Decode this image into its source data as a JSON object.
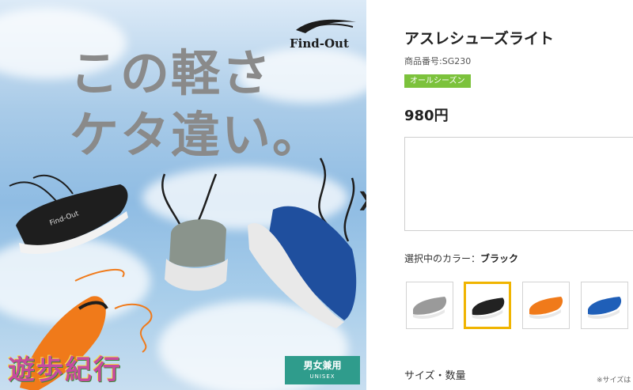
{
  "banner": {
    "brand": "Find-Out",
    "headline_line1": "この軽さ",
    "headline_line2": "ケタ違い。",
    "unisex_main": "男女兼用",
    "unisex_sub": "UNISEX",
    "watermark": "遊歩紀行",
    "next_arrow": "❯",
    "shoe_colors": [
      "#1e1e1e",
      "#8a948c",
      "#1f4f9e",
      "#f07a1a"
    ]
  },
  "product": {
    "title": "アスレシューズライト",
    "code": "商品番号:SG230",
    "badge": "オールシーズン",
    "badge_color": "#7cc23c",
    "price": "980円",
    "selected_color_label": "選択中のカラー：",
    "selected_color_value": "ブラック",
    "swatches": [
      {
        "color": "gray",
        "body": "#9a9a9a",
        "selected": false
      },
      {
        "color": "black",
        "body": "#222222",
        "selected": true
      },
      {
        "color": "orange",
        "body": "#f07a1a",
        "selected": false
      },
      {
        "color": "blue",
        "body": "#1f5fb8",
        "selected": false
      }
    ],
    "size_label": "サイズ・数量",
    "size_note": "※サイズは"
  }
}
